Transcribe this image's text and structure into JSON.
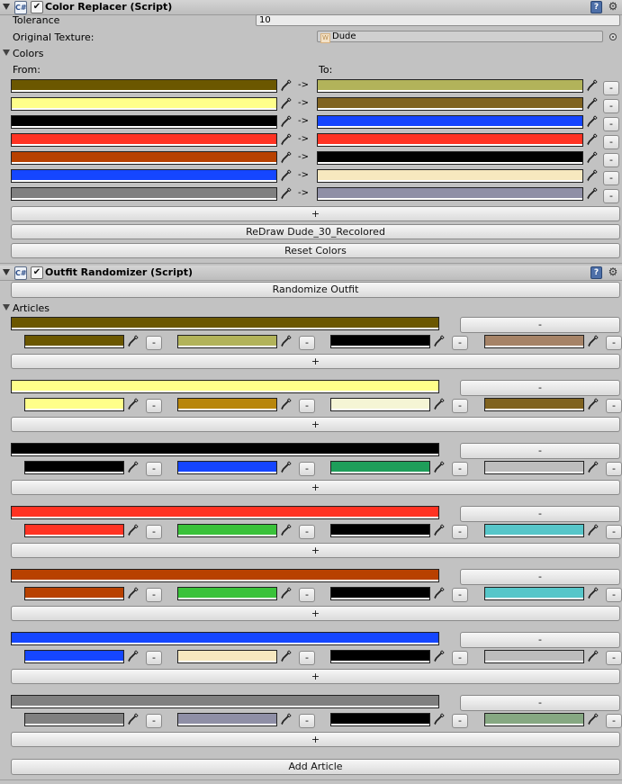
{
  "color_replacer": {
    "title": "Color Replacer (Script)",
    "script_icon": "C#",
    "enabled": "✔",
    "tolerance_label": "Tolerance",
    "tolerance_value": "10",
    "original_texture_label": "Original Texture:",
    "original_texture_value": "Dude",
    "colors_label": "Colors",
    "from_label": "From:",
    "to_label": "To:",
    "arrow": "->",
    "remove_label": "-",
    "add_label": "+",
    "redraw_label": "ReDraw Dude_30_Recolored",
    "reset_label": "Reset Colors",
    "rows": [
      {
        "from": "#6b5700",
        "to": "#b2b35a"
      },
      {
        "from": "#ffff8a",
        "to": "#806320"
      },
      {
        "from": "#000000",
        "to": "#1545ff"
      },
      {
        "from": "#ff3323",
        "to": "#ff3323"
      },
      {
        "from": "#b84100",
        "to": "#000000"
      },
      {
        "from": "#1546ff",
        "to": "#f7e8bf"
      },
      {
        "from": "#808080",
        "to": "#8f8fa6"
      }
    ]
  },
  "outfit_randomizer": {
    "title": "Outfit Randomizer (Script)",
    "script_icon": "C#",
    "enabled": "✔",
    "randomize_label": "Randomize Outfit",
    "articles_label": "Articles",
    "remove_label": "-",
    "add_label": "+",
    "add_article_label": "Add Article",
    "articles": [
      {
        "base": "#6b5700",
        "variants": [
          "#6b5700",
          "#b2b35a",
          "#000000",
          "#a68367"
        ]
      },
      {
        "base": "#ffff8a",
        "variants": [
          "#ffff8a",
          "#b8860b",
          "#f5f5d5",
          "#806320"
        ]
      },
      {
        "base": "#000000",
        "variants": [
          "#000000",
          "#1545ff",
          "#1e9e5a",
          "#bdbdbd"
        ]
      },
      {
        "base": "#ff3323",
        "variants": [
          "#ff3323",
          "#3ac23a",
          "#000000",
          "#56c6c9"
        ]
      },
      {
        "base": "#b84100",
        "variants": [
          "#b84100",
          "#3ac23a",
          "#000000",
          "#56c6c9"
        ]
      },
      {
        "base": "#1546ff",
        "variants": [
          "#1546ff",
          "#f7e8bf",
          "#000000",
          "#bdbdbd"
        ]
      },
      {
        "base": "#808080",
        "variants": [
          "#808080",
          "#8f8fa6",
          "#000000",
          "#86a882"
        ]
      }
    ]
  },
  "icons": {
    "help": "?",
    "gear": "⚙",
    "fold": "triangle-down",
    "dropper": "eyedropper"
  }
}
